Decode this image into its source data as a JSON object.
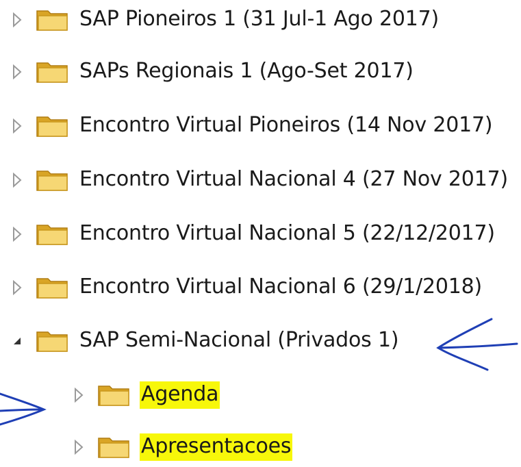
{
  "tree": {
    "items": [
      {
        "label": "SAP Pioneiros 1 (31 Jul-1 Ago 2017)",
        "state": "collapsed",
        "level": 0,
        "highlight": false
      },
      {
        "label": "SAPs Regionais 1 (Ago-Set 2017)",
        "state": "collapsed",
        "level": 0,
        "highlight": false
      },
      {
        "label": "Encontro Virtual Pioneiros (14 Nov 2017)",
        "state": "collapsed",
        "level": 0,
        "highlight": false
      },
      {
        "label": "Encontro Virtual Nacional 4 (27 Nov 2017)",
        "state": "collapsed",
        "level": 0,
        "highlight": false
      },
      {
        "label": "Encontro Virtual Nacional 5 (22/12/2017)",
        "state": "collapsed",
        "level": 0,
        "highlight": false
      },
      {
        "label": "Encontro Virtual Nacional 6 (29/1/2018)",
        "state": "collapsed",
        "level": 0,
        "highlight": false
      },
      {
        "label": "SAP Semi-Nacional (Privados 1)",
        "state": "expanded",
        "level": 0,
        "highlight": false
      },
      {
        "label": "Agenda",
        "state": "collapsed",
        "level": 1,
        "highlight": true
      },
      {
        "label": "Apresentacoes",
        "state": "collapsed",
        "level": 1,
        "highlight": true
      }
    ]
  },
  "icons": {
    "collapsed": "chevron-right-outline-icon",
    "expanded": "triangle-down-filled-icon",
    "folder": "folder-icon"
  },
  "colors": {
    "highlight": "#f7f70a",
    "annotation_ink": "#1f3fb5",
    "text": "#1a1a1a",
    "arrow_outline": "#9a9a9a"
  },
  "annotations": [
    "arrow-left-annotation",
    "arrow-right-annotation"
  ]
}
